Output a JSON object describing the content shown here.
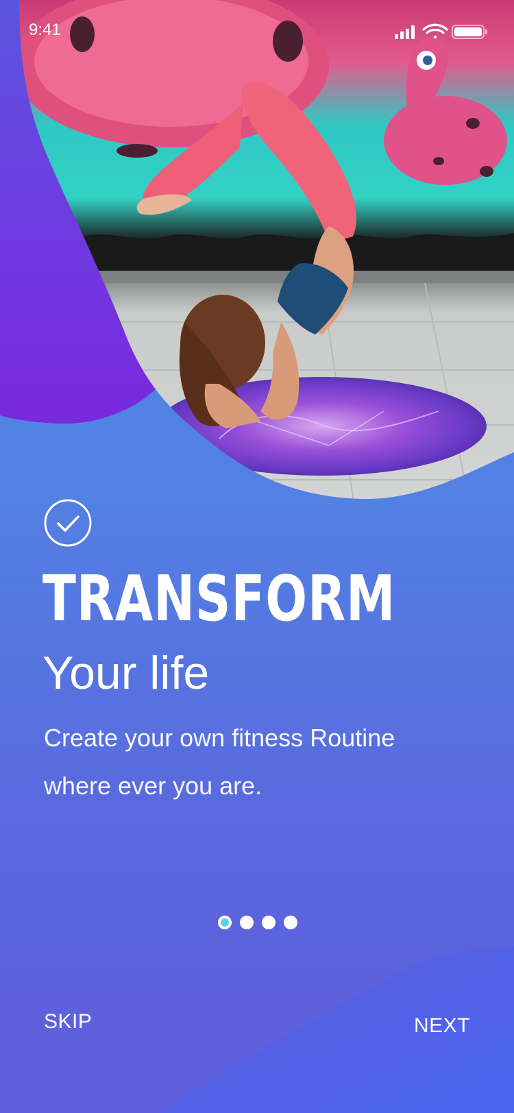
{
  "status_bar": {
    "time": "9:41",
    "icons": [
      "signal-icon",
      "wifi-icon",
      "battery-icon"
    ]
  },
  "hero": {
    "photo_description_icon": "yoga-photo",
    "check_icon": "check-circle-icon"
  },
  "content": {
    "title": "TRANSFORM",
    "subtitle": "Your life",
    "description_line1": "Create your own fitness Routine",
    "description_line2": "where ever you are."
  },
  "pagination": {
    "total": 4,
    "active_index": 0
  },
  "footer": {
    "skip_label": "SKIP",
    "next_label": "NEXT"
  },
  "colors": {
    "background_top": "#4a8ae4",
    "background_bottom": "#5f5ddb",
    "accent_purple": "#7a2de0",
    "accent_blue": "#4a6cf0",
    "active_dot": "#5ad0f0",
    "text": "#ffffff"
  }
}
